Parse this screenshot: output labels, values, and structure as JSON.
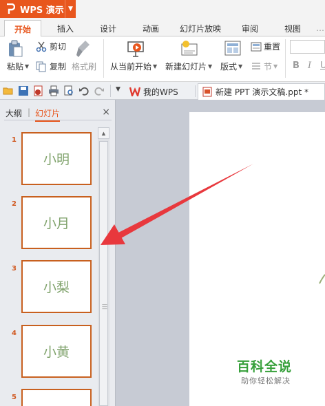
{
  "app": {
    "name": "WPS 演示"
  },
  "tabs": [
    {
      "label": "开始",
      "active": true
    },
    {
      "label": "插入"
    },
    {
      "label": "设计"
    },
    {
      "label": "动画"
    },
    {
      "label": "幻灯片放映"
    },
    {
      "label": "审阅"
    },
    {
      "label": "视图"
    }
  ],
  "ribbon": {
    "paste": "粘贴",
    "cut": "剪切",
    "copy": "复制",
    "format_painter": "格式刷",
    "from_current": "从当前开始",
    "new_slide": "新建幻灯片",
    "layout": "版式",
    "reset": "重置",
    "section": "节",
    "bold": "B",
    "italic": "I",
    "underline": "U"
  },
  "doc_tabs": [
    {
      "label": "我的WPS",
      "active": false
    },
    {
      "label": "新建 PPT 演示文稿.ppt *",
      "active": true
    }
  ],
  "panel": {
    "outline_tab": "大纲",
    "slides_tab": "幻灯片",
    "close": "×"
  },
  "slides": [
    {
      "number": "1",
      "text": "小明"
    },
    {
      "number": "2",
      "text": "小月"
    },
    {
      "number": "3",
      "text": "小梨"
    },
    {
      "number": "4",
      "text": "小黄"
    },
    {
      "number": "5",
      "text": ""
    }
  ],
  "watermark": {
    "title": "百科全说",
    "subtitle": "助你轻松解决"
  },
  "colors": {
    "accent": "#e8561d",
    "thumb_border": "#c8601f",
    "thumb_text": "#7fa26b",
    "arrow": "#e8383d",
    "watermark": "#37a03b"
  }
}
